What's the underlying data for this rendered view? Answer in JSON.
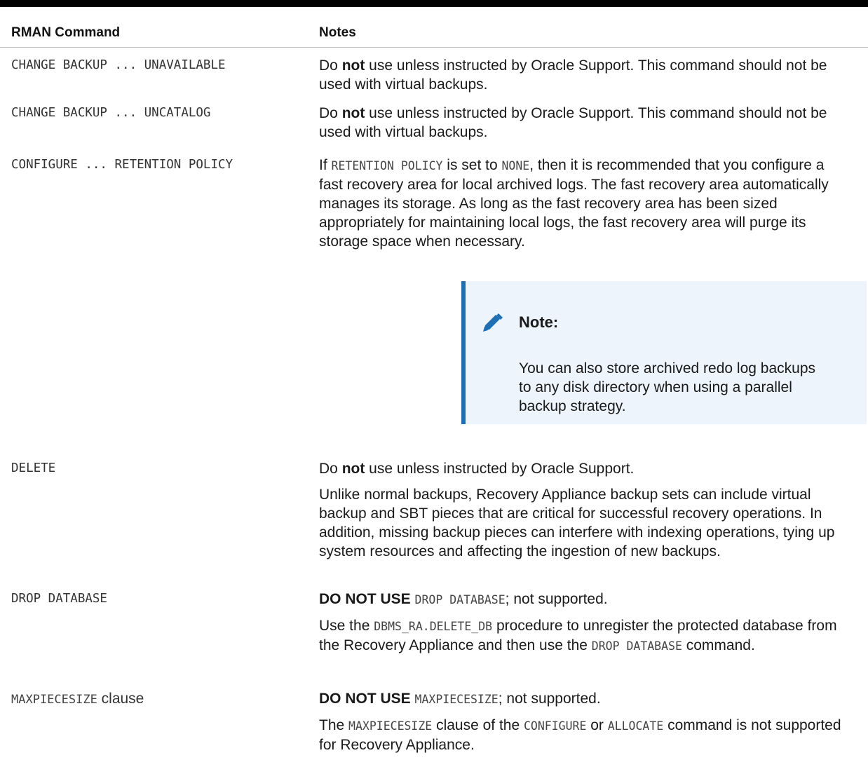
{
  "table": {
    "headers": {
      "command": "RMAN Command",
      "notes": "Notes"
    },
    "rows": [
      {
        "command": "CHANGE BACKUP ... UNAVAILABLE",
        "note": {
          "pre": "Do ",
          "bold": "not",
          "post": " use unless instructed by Oracle Support. This command should not be used with virtual backups."
        }
      },
      {
        "command": "CHANGE BACKUP ... UNCATALOG",
        "note": {
          "pre": "Do ",
          "bold": "not",
          "post": " use unless instructed by Oracle Support. This command should not be used with virtual backups."
        }
      },
      {
        "command": "CONFIGURE ... RETENTION POLICY",
        "note": {
          "t1": "If ",
          "m1": "RETENTION POLICY",
          "t2": " is set to ",
          "m2": "NONE",
          "t3": ", then it is recommended that you configure a fast recovery area for local archived logs. The fast recovery area automatically manages its storage. As long as the fast recovery area has been sized appropriately for maintaining local logs, the fast recovery area will purge its storage space when necessary."
        },
        "callout": {
          "icon": "pencil-icon",
          "title": "Note:",
          "body": "You can also store archived redo log backups to any disk directory when using a parallel backup strategy."
        }
      },
      {
        "command": "DELETE",
        "note1": {
          "pre": "Do ",
          "bold": "not",
          "post": " use unless instructed by Oracle Support."
        },
        "note2": "Unlike normal backups, Recovery Appliance backup sets can include virtual backup and SBT pieces that are critical for successful recovery operations. In addition, missing backup pieces can interfere with indexing operations, tying up system resources and affecting the ingestion of new backups."
      },
      {
        "command": "DROP DATABASE",
        "note1": {
          "bold": "DO NOT USE",
          "mono": "DROP DATABASE",
          "post": "; not supported."
        },
        "note2": {
          "t1": "Use the ",
          "m1": "DBMS_RA.DELETE_DB",
          "t2": " procedure to unregister the protected database from the Recovery Appliance and then use the ",
          "m2": "DROP DATABASE",
          "t3": " command."
        }
      },
      {
        "command_mono": "MAXPIECESIZE",
        "command_text": " clause",
        "note1": {
          "bold": "DO NOT USE",
          "mono": "MAXPIECESIZE",
          "post": "; not supported."
        },
        "note2": {
          "t1": "The ",
          "m1": "MAXPIECESIZE",
          "t2": " clause of the ",
          "m2": "CONFIGURE",
          "t3": " or ",
          "m3": "ALLOCATE",
          "t4": " command is not supported for Recovery Appliance."
        }
      }
    ]
  },
  "colors": {
    "callout_bg": "#eef4fb",
    "callout_border": "#1f6fb5",
    "icon": "#1f6fb5"
  }
}
